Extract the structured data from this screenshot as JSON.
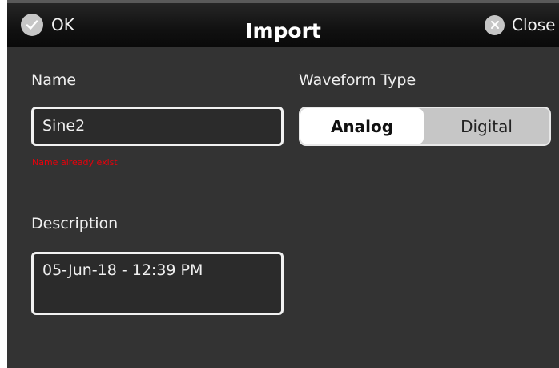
{
  "titlebar": {
    "title": "Import",
    "ok_label": "OK",
    "close_label": "Close"
  },
  "form": {
    "name_label": "Name",
    "name_value": "Sine2",
    "name_error": "Name already exist",
    "description_label": "Description",
    "description_value": "05-Jun-18 - 12:39 PM",
    "waveform_label": "Waveform Type",
    "waveform_options": [
      "Analog",
      "Digital"
    ],
    "waveform_selected": "Analog"
  },
  "colors": {
    "background": "#333333",
    "error": "#e8000b",
    "selected_segment": "#ffffff",
    "unselected_segment": "#c6c6c6"
  },
  "icons": {
    "ok": "check-circle-icon",
    "close": "x-circle-icon"
  }
}
